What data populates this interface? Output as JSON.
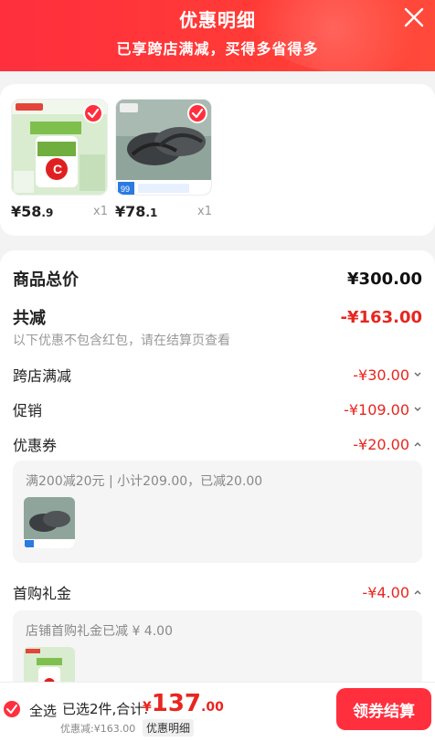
{
  "header": {
    "title": "优惠明细",
    "subtitle": "已享跨店满减，买得多省得多"
  },
  "products": [
    {
      "price_int": "¥58",
      "price_dec": ".9",
      "qty": "x1",
      "image": "vitamin-c-product"
    },
    {
      "price_int": "¥78",
      "price_dec": ".1",
      "qty": "x1",
      "image": "sandals-product"
    }
  ],
  "summary": {
    "goods_total_label": "商品总价",
    "goods_total_value": "¥300.00",
    "total_discount_label": "共减",
    "total_discount_value": "-¥163.00",
    "note": "以下优惠不包含红包，请在结算页查看",
    "cross_store_label": "跨店满减",
    "cross_store_value": "-¥30.00",
    "promo_label": "促销",
    "promo_value": "-¥109.00",
    "coupon_label": "优惠券",
    "coupon_value": "-¥20.00",
    "coupon_detail": "满200减20元 | 小计209.00，已减20.00",
    "gift_label": "首购礼金",
    "gift_value": "-¥4.00",
    "gift_detail": "店铺首购礼金已减 ¥ 4.00"
  },
  "bottom": {
    "select_all": "全选",
    "selected": "已选2件,合计:",
    "yen": "¥",
    "amount": "137",
    "decimal": ".00",
    "discount": "优惠减:¥163.00",
    "detail_button": "优惠明细",
    "pay_button": "领券结算"
  },
  "colors": {
    "accent": "#ff2f3e",
    "discount_red": "#e8261f"
  }
}
